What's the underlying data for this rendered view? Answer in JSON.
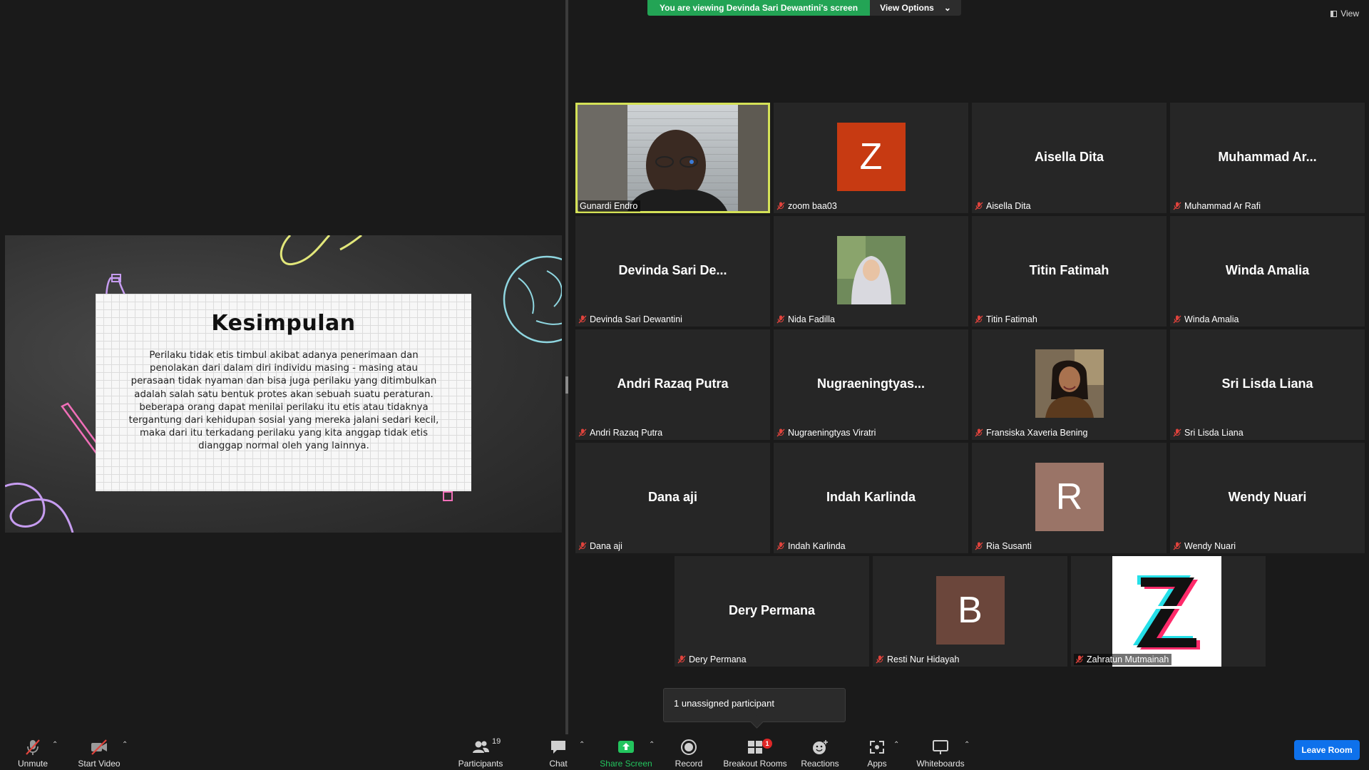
{
  "banner": {
    "message": "You are viewing Devinda Sari Dewantini's screen",
    "view_options": "View Options",
    "caret": "⌄"
  },
  "view_button": {
    "label": "View"
  },
  "slide": {
    "title": "Kesimpulan",
    "body": "Perilaku tidak etis timbul akibat adanya penerimaan dan penolakan dari dalam diri individu masing - masing atau perasaan tidak nyaman dan bisa juga perilaku yang ditimbulkan adalah salah satu bentuk protes akan sebuah suatu peraturan. beberapa orang dapat menilai perilaku itu etis atau tidaknya tergantung dari kehidupan sosial yang mereka jalani sedari kecil, maka dari itu terkadang perilaku yang kita anggap tidak etis dianggap normal oleh yang lainnya."
  },
  "participants": [
    {
      "label": "Gunardi Endro",
      "display": "",
      "kind": "video",
      "active": true
    },
    {
      "label": "zoom baa03",
      "display": "Z",
      "kind": "letter",
      "color": "#c73a12"
    },
    {
      "label": "Aisella Dita",
      "display": "Aisella Dita",
      "kind": "name"
    },
    {
      "label": "Muhammad Ar Rafi",
      "display": "Muhammad  Ar...",
      "kind": "name"
    },
    {
      "label": "Devinda Sari Dewantini",
      "display": "Devinda  Sari  De...",
      "kind": "name"
    },
    {
      "label": "Nida Fadilla",
      "display": "",
      "kind": "photo-hijab"
    },
    {
      "label": "Titin Fatimah",
      "display": "Titin Fatimah",
      "kind": "name"
    },
    {
      "label": "Winda Amalia",
      "display": "Winda Amalia",
      "kind": "name"
    },
    {
      "label": "Andri Razaq Putra",
      "display": "Andri Razaq Putra",
      "kind": "name"
    },
    {
      "label": "Nugraeningtyas Viratri",
      "display": "Nugraeningtyas...",
      "kind": "name"
    },
    {
      "label": "Fransiska Xaveria Bening",
      "display": "",
      "kind": "photo-woman"
    },
    {
      "label": "Sri Lisda Liana",
      "display": "Sri Lisda Liana",
      "kind": "name"
    },
    {
      "label": "Dana aji",
      "display": "Dana aji",
      "kind": "name"
    },
    {
      "label": "Indah Karlinda",
      "display": "Indah Karlinda",
      "kind": "name"
    },
    {
      "label": "Ria Susanti",
      "display": "R",
      "kind": "letter",
      "color": "#9a7467"
    },
    {
      "label": "Wendy Nuari",
      "display": "Wendy Nuari",
      "kind": "name"
    },
    {
      "label": "Dery Permana",
      "display": "Dery Permana",
      "kind": "name"
    },
    {
      "label": "Resti Nur Hidayah",
      "display": "B",
      "kind": "letter",
      "color": "#6b463b"
    },
    {
      "label": "Zahratun Mutmainah",
      "display": "",
      "kind": "logo-z"
    }
  ],
  "tooltip": {
    "text": "1 unassigned participant"
  },
  "toolbar": {
    "unmute": "Unmute",
    "start_video": "Start Video",
    "participants": "Participants",
    "participants_count": "19",
    "chat": "Chat",
    "share_screen": "Share Screen",
    "record": "Record",
    "breakout_rooms": "Breakout Rooms",
    "breakout_badge": "1",
    "reactions": "Reactions",
    "apps": "Apps",
    "whiteboards": "Whiteboards",
    "leave_room": "Leave Room",
    "caret": "⌃"
  },
  "colors": {
    "share_green": "#23a455",
    "leave_blue": "#0e71eb",
    "active_border": "#d4e157",
    "tile_bg": "#262626",
    "mute_red": "#e0433c"
  },
  "icons": [
    "shield-icon",
    "view-layout-icon",
    "mic-off-icon",
    "video-off-icon",
    "participants-icon",
    "chat-icon",
    "share-screen-icon",
    "record-icon",
    "breakout-rooms-icon",
    "reactions-icon",
    "apps-icon",
    "whiteboards-icon"
  ]
}
